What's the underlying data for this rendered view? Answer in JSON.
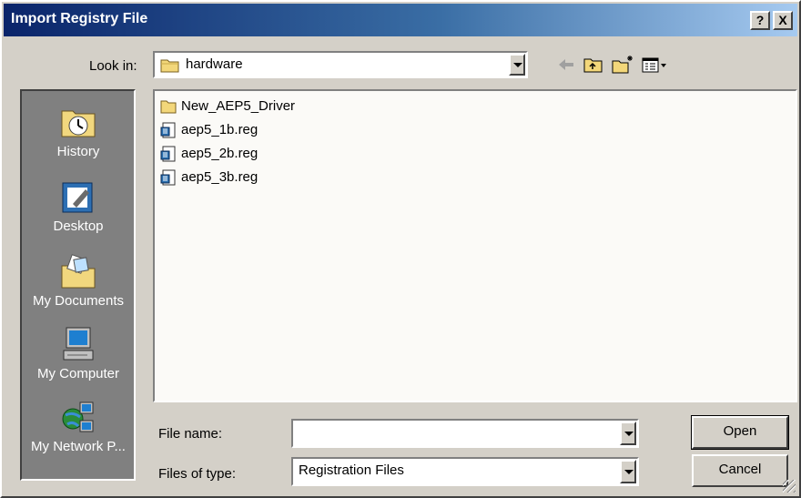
{
  "window": {
    "title": "Import Registry File"
  },
  "title_buttons": {
    "help": "?",
    "close": "X"
  },
  "lookin": {
    "label": "Look in:",
    "value": "hardware"
  },
  "toolbar": [
    {
      "name": "back-icon"
    },
    {
      "name": "up-folder-icon"
    },
    {
      "name": "new-folder-icon"
    },
    {
      "name": "view-menu-icon"
    }
  ],
  "places": [
    {
      "label": "History",
      "icon": "history-icon"
    },
    {
      "label": "Desktop",
      "icon": "desktop-icon"
    },
    {
      "label": "My Documents",
      "icon": "my-documents-icon"
    },
    {
      "label": "My Computer",
      "icon": "my-computer-icon"
    },
    {
      "label": "My Network P...",
      "icon": "my-network-places-icon"
    }
  ],
  "files": [
    {
      "name": "New_AEP5_Driver",
      "type": "folder"
    },
    {
      "name": "aep5_1b.reg",
      "type": "reg"
    },
    {
      "name": "aep5_2b.reg",
      "type": "reg"
    },
    {
      "name": "aep5_3b.reg",
      "type": "reg"
    }
  ],
  "filename": {
    "label": "File name:",
    "value": ""
  },
  "filetype": {
    "label": "Files of type:",
    "value": "Registration Files"
  },
  "buttons": {
    "open": "Open",
    "cancel": "Cancel"
  }
}
